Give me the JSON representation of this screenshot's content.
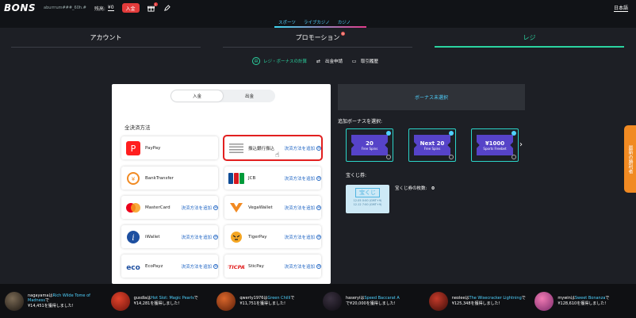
{
  "header": {
    "logo": "BONS",
    "username": "aburrrum###_60h.#",
    "balance_label": "残高:",
    "balance": "¥0",
    "deposit_button": "入金",
    "gift_badge": "1",
    "language": "日本語"
  },
  "categories": [
    "スポーツ",
    "ライブカジノ",
    "カジノ"
  ],
  "tabs": [
    {
      "label": "アカウント",
      "active": false
    },
    {
      "label": "プロモーション",
      "active": false,
      "badge": "9"
    },
    {
      "label": "レジ",
      "active": true
    }
  ],
  "subtabs": [
    {
      "label": "レジ・ボーナスの計算",
      "active": true
    },
    {
      "label": "出金申請",
      "active": false
    },
    {
      "label": "取引履歴",
      "active": false
    }
  ],
  "toggle": {
    "deposit": "入金",
    "withdraw": "出金"
  },
  "methods_title": "全決済方法",
  "payment_methods": [
    {
      "name": "PayPay",
      "add": ""
    },
    {
      "name": "振込銀行振込",
      "add": "決済方法を追加"
    },
    {
      "name": "BankTransfer",
      "add": ""
    },
    {
      "name": "JCB",
      "add": "決済方法を追加"
    },
    {
      "name": "MasterCard",
      "add": "決済方法を追加"
    },
    {
      "name": "VegaWallet",
      "add": "決済方法を追加"
    },
    {
      "name": "iWallet",
      "add": "決済方法を追加"
    },
    {
      "name": "TigerPay",
      "add": "決済方法を追加"
    },
    {
      "name": "EcoPayz",
      "add": "決済方法を追加"
    },
    {
      "name": "SticPay",
      "add": "決済方法を追加"
    }
  ],
  "bonus": {
    "none_selected": "ボーナス未選択",
    "add_title": "追加ボーナスを選択:",
    "cards": [
      {
        "big": "20",
        "small": "Free Spins"
      },
      {
        "big": "Next 20",
        "small": "Free Spins"
      },
      {
        "big": "¥1000",
        "small": "Sports Freebet"
      }
    ]
  },
  "lottery": {
    "title": "宝くじ券:",
    "ticket_label": "宝くじ",
    "ticket_line1": "12.05 0:00 (GMT+9)",
    "ticket_line2": "12.12 7:00 (GMT+9)",
    "count_label": "宝くじ券の枚数:",
    "count": "0"
  },
  "side_tab": "最新の勝利者",
  "winners": [
    {
      "user": "nagayama",
      "prefix": "は",
      "game": "Rich Wilde Tome of Madness",
      "suffix": "で",
      "amount": "¥14,451",
      "tail": "を獲得しました!"
    },
    {
      "user": "gusdla",
      "prefix": "は",
      "game": "Hot Slot: Magic Pearls",
      "suffix": "で",
      "amount": "¥14,281",
      "tail": "を獲得しました!"
    },
    {
      "user": "qwerty1976",
      "prefix": "は",
      "game": "Green Chilli",
      "suffix": "で",
      "amount": "¥11,751",
      "tail": "を獲得しました!"
    },
    {
      "user": "haseryi",
      "prefix": "は",
      "game": "Speed Baccarat A",
      "suffix": "で",
      "amount": "¥20,000",
      "tail": "を獲得しました!"
    },
    {
      "user": "neoleeは",
      "prefix": "",
      "game": "The Wisecracker Lightning",
      "suffix": "で",
      "amount": "¥125,348",
      "tail": "を獲得しました!"
    },
    {
      "user": "mywin",
      "prefix": "は",
      "game": "Sweet Bonanza",
      "suffix": "で",
      "amount": "¥128,610",
      "tail": "を獲得しました!"
    }
  ],
  "colors": {
    "accent": "#2bd4a0",
    "link": "#4fd2ff",
    "deposit": "#e23b3b",
    "highlight": "#e21f1f",
    "side_tab": "#f18a22",
    "bonus": "#5643c8"
  }
}
